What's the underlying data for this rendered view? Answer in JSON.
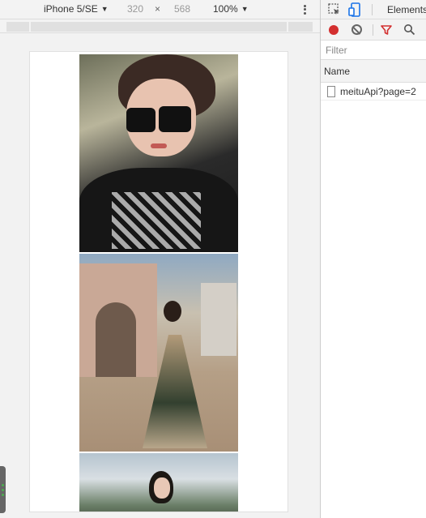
{
  "device_toolbar": {
    "device": "iPhone 5/SE",
    "width": "320",
    "times": "×",
    "height": "568",
    "zoom": "100%"
  },
  "devtools": {
    "tabs": [
      "Elements"
    ],
    "filter_placeholder": "Filter",
    "column_name": "Name",
    "requests": [
      {
        "name": "meituApi?page=2"
      }
    ]
  },
  "colors": {
    "record": "#d32f2f",
    "filter_accent": "#d32f2f",
    "device_icon_active": "#1a73e8"
  },
  "icons": {
    "more": "more-vert-icon",
    "inspect": "inspect-element-icon",
    "device": "device-toggle-icon",
    "record": "record-icon",
    "clear": "clear-icon",
    "filter": "filter-icon",
    "search": "search-icon",
    "file": "file-icon"
  }
}
